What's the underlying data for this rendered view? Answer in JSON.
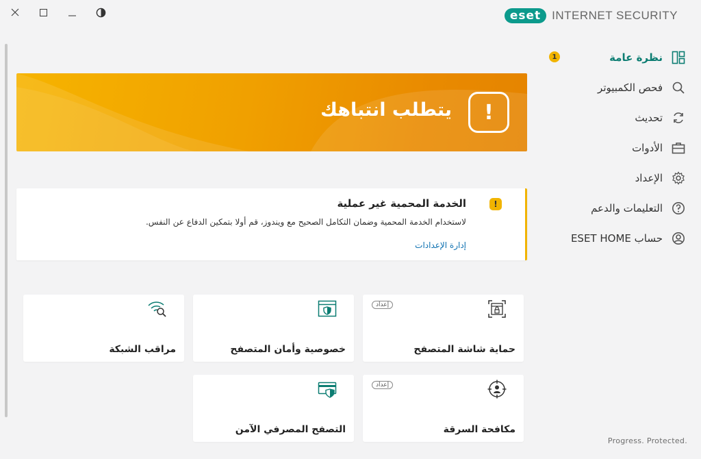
{
  "window": {
    "close_icon": "close-icon",
    "maximize_icon": "maximize-icon",
    "minimize_icon": "minimize-icon",
    "theme_icon": "theme-toggle-icon"
  },
  "brand": {
    "logo": "eset",
    "product": "INTERNET SECURITY",
    "accent": "#0c9a8c"
  },
  "nav": {
    "items": [
      {
        "label": "نظرة عامة",
        "icon": "dashboard-icon",
        "active": true,
        "badge": "1"
      },
      {
        "label": "فحص الكمبيوتر",
        "icon": "search-icon"
      },
      {
        "label": "تحديث",
        "icon": "refresh-icon"
      },
      {
        "label": "الأدوات",
        "icon": "toolbox-icon"
      },
      {
        "label": "الإعداد",
        "icon": "gear-icon"
      },
      {
        "label": "التعليمات والدعم",
        "icon": "help-icon"
      },
      {
        "label": "حساب ESET HOME",
        "icon": "account-icon"
      }
    ]
  },
  "banner": {
    "title": "يتطلب انتباهك",
    "icon": "exclamation-icon",
    "color": "#f0a000"
  },
  "alert": {
    "title": "الخدمة المحمية غير عملية",
    "description": "لاستخدام الخدمة المحمية وضمان التكامل الصحيح مع ويندوز، قم أولا بتمكين الدفاع عن النفس.",
    "link": "إدارة الإعدادات",
    "icon": "warning-icon",
    "color": "#f1b400"
  },
  "tiles": [
    {
      "label": "حماية شاشة المتصفح",
      "tag": "إعداد",
      "icon": "browser-lock-icon"
    },
    {
      "label": "خصوصية وأمان المتصفح",
      "icon": "browser-shield-icon"
    },
    {
      "label": "مراقب الشبكة",
      "icon": "network-inspector-icon"
    },
    {
      "label": "مكافحة السرقة",
      "tag": "إعداد",
      "icon": "anti-theft-icon"
    },
    {
      "label": "التصفح المصرفي الآمن",
      "icon": "banking-shield-icon"
    }
  ],
  "footer": {
    "tagline": "Progress. Protected."
  }
}
